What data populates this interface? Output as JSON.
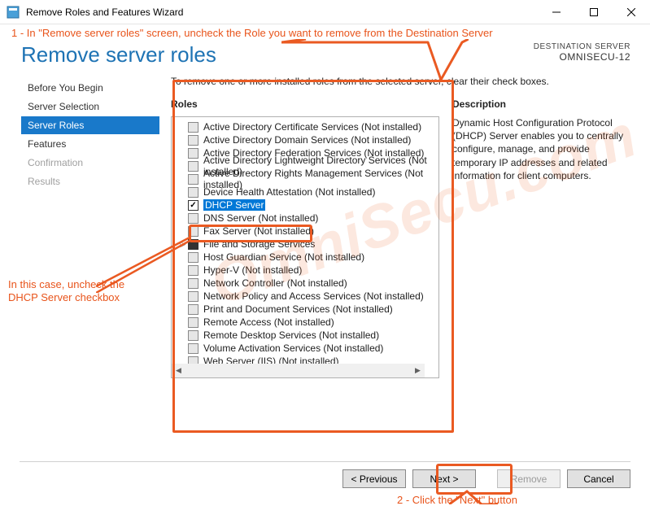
{
  "window": {
    "title": "Remove Roles and Features Wizard"
  },
  "annotations": {
    "top": "1 -  In \"Remove server roles\" screen, uncheck the Role you want to remove from the Destination Server",
    "left": "In this case, uncheck the DHCP Server checkbox",
    "bottom": "2 - Click the \"Next\" button"
  },
  "page_title": "Remove server roles",
  "destination": {
    "label": "DESTINATION SERVER",
    "name": "OMNISECU-12"
  },
  "nav": {
    "items": [
      {
        "label": "Before You Begin"
      },
      {
        "label": "Server Selection"
      },
      {
        "label": "Server Roles"
      },
      {
        "label": "Features"
      },
      {
        "label": "Confirmation"
      },
      {
        "label": "Results"
      }
    ]
  },
  "instruction": "To remove one or more installed roles from the selected server, clear their check boxes.",
  "columns": {
    "roles_head": "Roles",
    "desc_head": "Description"
  },
  "roles": [
    {
      "label": "Active Directory Certificate Services (Not installed)"
    },
    {
      "label": "Active Directory Domain Services (Not installed)"
    },
    {
      "label": "Active Directory Federation Services (Not installed)"
    },
    {
      "label": "Active Directory Lightweight Directory Services (Not installed)"
    },
    {
      "label": "Active Directory Rights Management Services (Not installed)"
    },
    {
      "label": "Device Health Attestation (Not installed)"
    },
    {
      "label": "DHCP Server"
    },
    {
      "label": "DNS Server (Not installed)"
    },
    {
      "label": "Fax Server (Not installed)"
    },
    {
      "label": "File and Storage Services"
    },
    {
      "label": "Host Guardian Service (Not installed)"
    },
    {
      "label": "Hyper-V (Not installed)"
    },
    {
      "label": "Network Controller (Not installed)"
    },
    {
      "label": "Network Policy and Access Services (Not installed)"
    },
    {
      "label": "Print and Document Services (Not installed)"
    },
    {
      "label": "Remote Access (Not installed)"
    },
    {
      "label": "Remote Desktop Services (Not installed)"
    },
    {
      "label": "Volume Activation Services (Not installed)"
    },
    {
      "label": "Web Server (IIS) (Not installed)"
    }
  ],
  "description": "Dynamic Host Configuration Protocol (DHCP) Server enables you to centrally configure, manage, and provide temporary IP addresses and related information for client computers.",
  "buttons": {
    "prev": "< Previous",
    "next": "Next >",
    "remove": "Remove",
    "cancel": "Cancel"
  },
  "watermark": "OmniSecu.com"
}
